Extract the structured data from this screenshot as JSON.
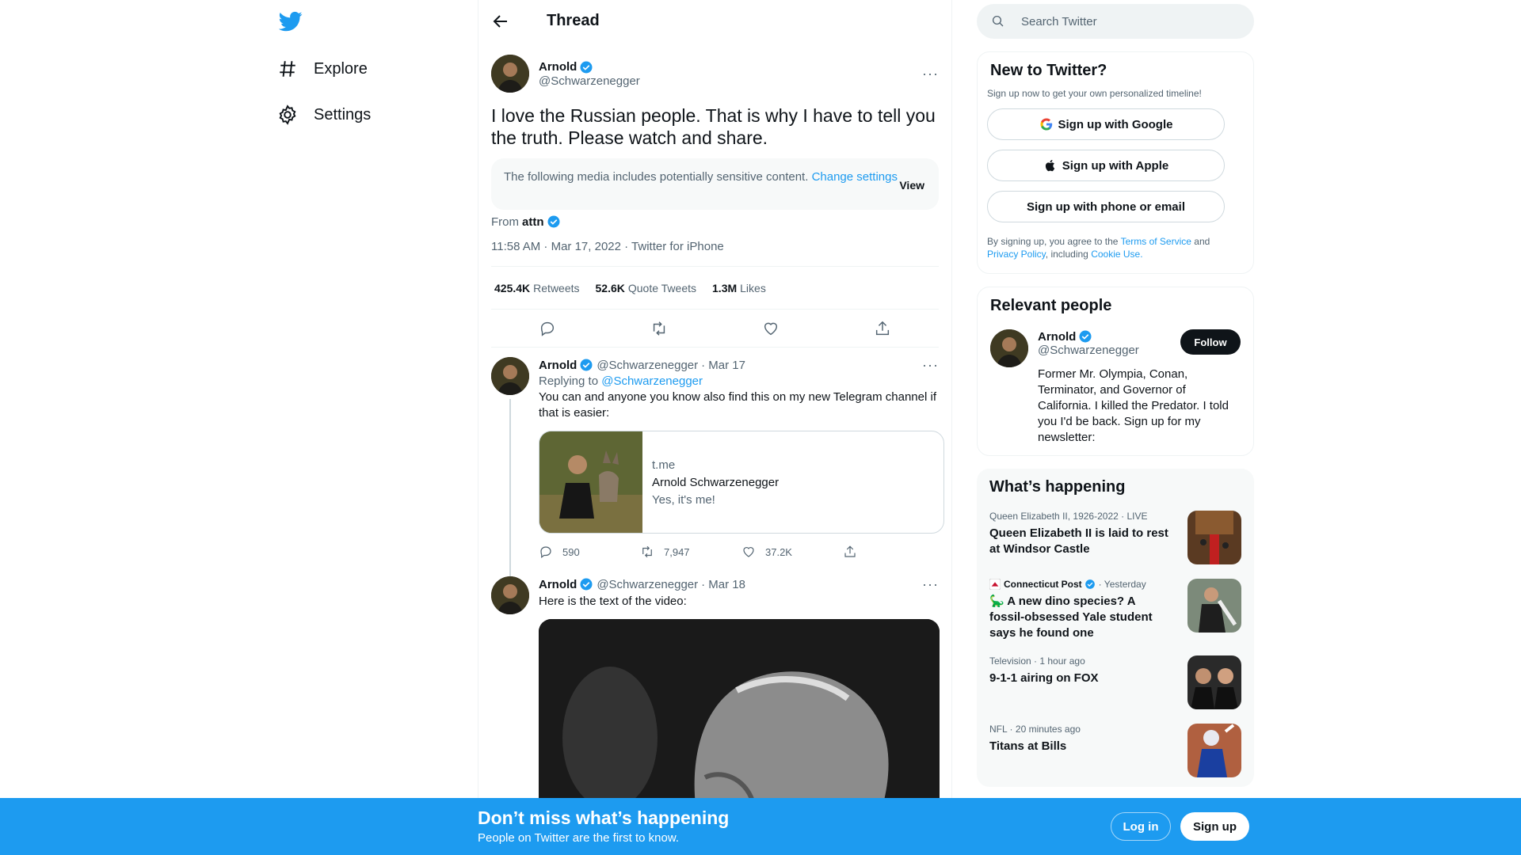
{
  "nav": {
    "logo": "twitter-bird-icon",
    "explore": "Explore",
    "settings": "Settings"
  },
  "header": {
    "title": "Thread"
  },
  "main_tweet": {
    "name": "Arnold",
    "handle": "@Schwarzenegger",
    "text": "I love the Russian people. That is why I have to tell you the truth. Please watch and share.",
    "sensitive_text": "The following media includes potentially sensitive content.",
    "sensitive_link": "Change settings",
    "view_label": "View",
    "from_label": "From",
    "from_name": "attn",
    "meta": "11:58 AM · Mar 17, 2022 · Twitter for iPhone",
    "retweets_count": "425.4K",
    "retweets_label": "Retweets",
    "quotes_count": "52.6K",
    "quotes_label": "Quote Tweets",
    "likes_count": "1.3M",
    "likes_label": "Likes"
  },
  "reply1": {
    "name": "Arnold",
    "handle": "@Schwarzenegger",
    "date": "· Mar 17",
    "replying_label": "Replying to",
    "replying_handle": "@Schwarzenegger",
    "text": "You can and anyone you know also find this on my new Telegram channel if that is easier:",
    "card_domain": "t.me",
    "card_title": "Arnold Schwarzenegger",
    "card_desc": "Yes, it's me!",
    "replies": "590",
    "retweets": "7,947",
    "likes": "37.2K"
  },
  "reply2": {
    "name": "Arnold",
    "handle": "@Schwarzenegger",
    "date": "· Mar 18",
    "text": "Here is the text of the video:"
  },
  "search": {
    "placeholder": "Search Twitter"
  },
  "new_to_twitter": {
    "title": "New to Twitter?",
    "subtitle": "Sign up now to get your own personalized timeline!",
    "google": "Sign up with Google",
    "apple": "Sign up with Apple",
    "phone": "Sign up with phone or email",
    "terms_prefix": "By signing up, you agree to the",
    "terms_link": "Terms of Service",
    "terms_and": "and",
    "privacy_link": "Privacy Policy",
    "terms_including": ", including",
    "cookie_link": "Cookie Use."
  },
  "relevant": {
    "title": "Relevant people",
    "name": "Arnold",
    "handle": "@Schwarzenegger",
    "follow": "Follow",
    "bio": "Former Mr. Olympia, Conan, Terminator, and Governor of California. I killed the Predator. I told you I'd be back. Sign up for my newsletter:"
  },
  "happening": {
    "title": "What’s happening",
    "trends": [
      {
        "context": "Queen Elizabeth II, 1926-2022 · LIVE",
        "title": "Queen Elizabeth II is laid to rest at Windsor Castle"
      },
      {
        "context_source": "Connecticut Post",
        "context_time": "· Yesterday",
        "title": "🦕 A new dino species? A fossil-obsessed Yale student says he found one"
      },
      {
        "context": "Television · 1 hour ago",
        "title": "9-1-1 airing on FOX"
      },
      {
        "context": "NFL · 20 minutes ago",
        "title": "Titans at Bills"
      }
    ]
  },
  "bottom_bar": {
    "title": "Don’t miss what’s happening",
    "subtitle": "People on Twitter are the first to know.",
    "login": "Log in",
    "signup": "Sign up"
  },
  "colors": {
    "accent": "#1d9bf0",
    "text": "#0f1419",
    "muted": "#536471"
  }
}
